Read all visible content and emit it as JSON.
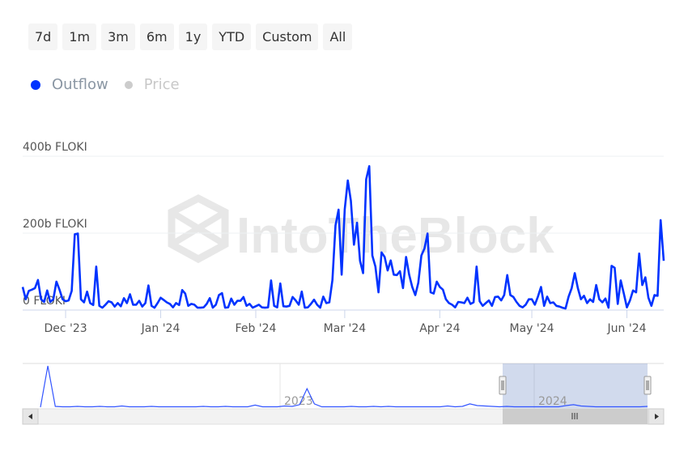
{
  "range_buttons": [
    "7d",
    "1m",
    "3m",
    "6m",
    "1y",
    "YTD",
    "Custom",
    "All"
  ],
  "legend": [
    {
      "label": "Outflow",
      "color": "#0033ff",
      "active": true
    },
    {
      "label": "Price",
      "color": "#cccccc",
      "active": false
    }
  ],
  "watermark": "IntoTheBlock",
  "chart_data": {
    "type": "line",
    "x_start": "2023-11-17",
    "x_end": "2024-06-13",
    "x_interval": "daily",
    "y_unit": "b FLOKI",
    "ylim": [
      0,
      400
    ],
    "y_ticks": [
      {
        "value": 0,
        "label": "0 FLOKI"
      },
      {
        "value": 200,
        "label": "200b FLOKI"
      },
      {
        "value": 400,
        "label": "400b FLOKI"
      }
    ],
    "x_ticks": [
      {
        "date": "2023-12-01",
        "label": "Dec '23"
      },
      {
        "date": "2024-01-01",
        "label": "Jan '24"
      },
      {
        "date": "2024-02-01",
        "label": "Feb '24"
      },
      {
        "date": "2024-03-01",
        "label": "Mar '24"
      },
      {
        "date": "2024-04-01",
        "label": "Apr '24"
      },
      {
        "date": "2024-05-01",
        "label": "May '24"
      },
      {
        "date": "2024-06-01",
        "label": "Jun '24"
      }
    ],
    "grid": true,
    "series": [
      {
        "name": "Outflow",
        "color": "#0033ff",
        "values": [
          60,
          28,
          50,
          53,
          57,
          78,
          28,
          21,
          51,
          21,
          28,
          74,
          53,
          28,
          23,
          25,
          50,
          197,
          199,
          28,
          20,
          48,
          18,
          13,
          113,
          11,
          6,
          14,
          23,
          20,
          9,
          18,
          10,
          31,
          18,
          41,
          14,
          14,
          24,
          9,
          18,
          64,
          11,
          6,
          18,
          32,
          26,
          20,
          16,
          7,
          18,
          13,
          52,
          43,
          11,
          16,
          14,
          6,
          6,
          7,
          16,
          31,
          6,
          14,
          39,
          44,
          6,
          7,
          30,
          14,
          24,
          24,
          34,
          11,
          16,
          6,
          10,
          14,
          7,
          6,
          7,
          77,
          11,
          7,
          69,
          10,
          9,
          11,
          34,
          25,
          14,
          48,
          6,
          7,
          16,
          27,
          14,
          6,
          35,
          18,
          20,
          78,
          220,
          261,
          92,
          262,
          337,
          284,
          170,
          227,
          128,
          96,
          340,
          374,
          142,
          113,
          46,
          150,
          138,
          103,
          129,
          92,
          91,
          101,
          57,
          138,
          92,
          60,
          39,
          71,
          142,
          160,
          199,
          46,
          43,
          74,
          60,
          53,
          28,
          18,
          14,
          7,
          21,
          20,
          18,
          32,
          16,
          20,
          113,
          23,
          11,
          18,
          25,
          11,
          34,
          35,
          25,
          39,
          91,
          39,
          34,
          21,
          11,
          7,
          14,
          28,
          28,
          14,
          35,
          60,
          11,
          35,
          18,
          20,
          11,
          9,
          6,
          4,
          35,
          57,
          96,
          57,
          28,
          37,
          18,
          28,
          21,
          65,
          28,
          20,
          30,
          6,
          115,
          110,
          16,
          77,
          43,
          7,
          25,
          51,
          46,
          147,
          65,
          85,
          32,
          11,
          39,
          37,
          234,
          128
        ]
      }
    ],
    "navigator": {
      "labels": [
        "2023",
        "2024"
      ],
      "values": [
        0,
        100,
        2,
        1,
        1,
        2,
        1,
        1,
        2,
        1,
        1,
        3,
        1,
        1,
        1,
        2,
        1,
        1,
        1,
        1,
        1,
        1,
        2,
        1,
        1,
        2,
        1,
        1,
        1,
        5,
        1,
        1,
        1,
        3,
        2,
        6,
        45,
        8,
        1,
        1,
        1,
        1,
        2,
        1,
        1,
        2,
        1,
        2,
        1,
        1,
        1,
        1,
        1,
        1,
        1,
        3,
        1,
        2,
        8,
        4,
        3,
        2,
        1,
        2,
        1,
        1,
        1,
        1,
        1,
        1,
        1,
        4,
        6,
        3,
        2,
        1,
        1,
        1,
        1,
        1,
        1,
        1,
        2
      ]
    }
  }
}
